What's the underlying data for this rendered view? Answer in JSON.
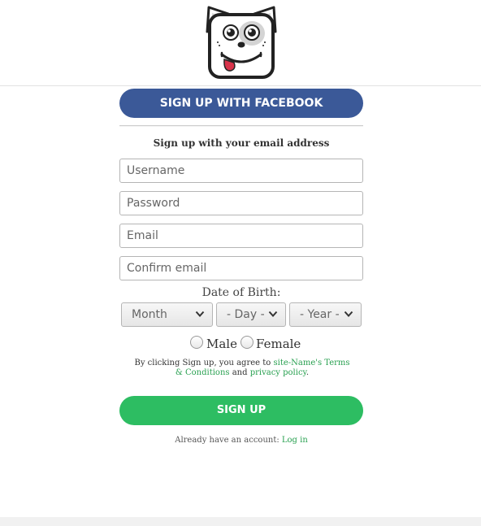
{
  "header": {
    "logo_icon": "dog-face-icon"
  },
  "signup": {
    "facebook_button": "SIGN UP WITH FACEBOOK",
    "email_heading": "Sign up with your email address",
    "fields": {
      "username_placeholder": "Username",
      "password_placeholder": "Password",
      "email_placeholder": "Email",
      "confirm_email_placeholder": "Confirm email"
    },
    "dob": {
      "label": "Date of Birth:",
      "month": "Month",
      "day": "- Day -",
      "year": "- Year -"
    },
    "gender": {
      "male": "Male",
      "female": "Female"
    },
    "terms": {
      "prefix": "By clicking Sign up, you agree to ",
      "terms_link": "site-Name's Terms & Conditions",
      "and": " and ",
      "privacy_link": "privacy policy",
      "suffix": "."
    },
    "submit_button": "SIGN UP",
    "login_prompt": "Already have an account: ",
    "login_link": "Log in"
  },
  "colors": {
    "facebook": "#3b5998",
    "signup_green": "#2dbd62",
    "link_green": "#28a050"
  }
}
